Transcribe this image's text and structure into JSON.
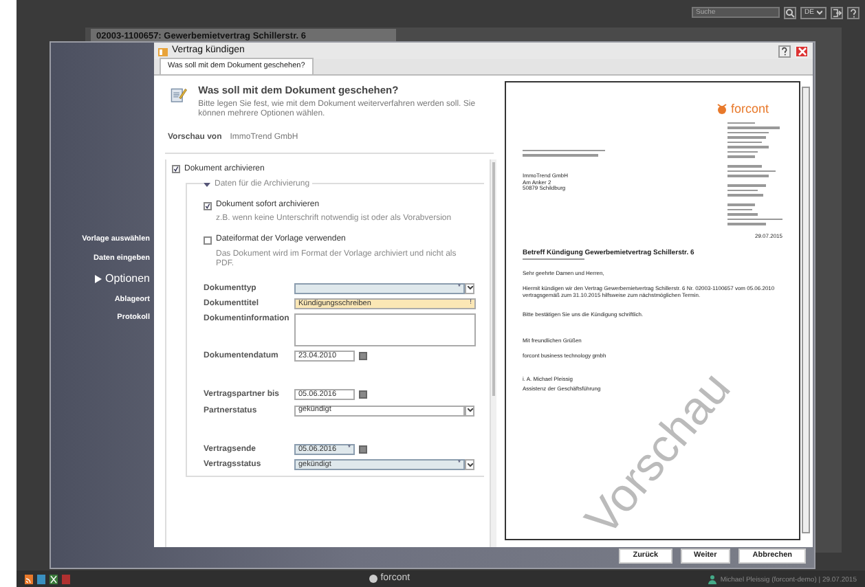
{
  "app_bar": {
    "search": {
      "placeholder": "Suche"
    },
    "language": "DE"
  },
  "background_window": {
    "title": "02003-1100657: Gewerbemietvertrag Schillerstr. 6"
  },
  "dialog": {
    "title": "Vertrag kündigen",
    "steps": [
      {
        "label": "Vorlage auswählen",
        "selected": false
      },
      {
        "label": "Daten eingeben",
        "selected": false
      },
      {
        "label": "Optionen",
        "selected": true
      },
      {
        "label": "Ablageort",
        "selected": false
      },
      {
        "label": "Protokoll",
        "selected": false
      }
    ],
    "tabs": [
      {
        "label": "Was soll mit dem Dokument geschehen?",
        "selected": true
      }
    ],
    "header": {
      "title": "Was soll mit dem Dokument geschehen?",
      "text": "Bitte legen Sie fest, wie mit dem Dokument weiterverfahren werden soll. Sie können mehrere Optionen wählen."
    },
    "preview_of": {
      "label": "Vorschau von",
      "value": "ImmoTrend GmbH"
    },
    "archive": {
      "label": "Dokument archivieren",
      "checked": true
    },
    "group": {
      "title": "Daten für die Archivierung",
      "expanded": true
    },
    "options": [
      {
        "label": "Dokument sofort archivieren",
        "hint": "z.B. wenn keine Unterschrift notwendig ist oder als Vorabversion",
        "checked": true
      },
      {
        "label": "Dateiformat der Vorlage verwenden",
        "hint": "Das Dokument wird im Format der Vorlage archiviert und nicht als PDF.",
        "checked": false
      }
    ],
    "field_groups": [
      [
        {
          "kind": "select",
          "label": "Dokumenttyp",
          "required": true,
          "warning": false,
          "marker": "*"
        },
        {
          "kind": "text",
          "label": "Dokumenttitel",
          "value": "Kündigungsschreiben",
          "required": false,
          "warning": true,
          "marker": "!"
        },
        {
          "kind": "textarea",
          "label": "Dokumentinformation",
          "required": false,
          "warning": false
        },
        {
          "kind": "date",
          "label": "Dokumentendatum",
          "value": "23.04.2010",
          "required": false,
          "warning": false
        }
      ],
      [
        {
          "kind": "date",
          "label": "Vertragspartner bis",
          "value": "05.06.2016",
          "required": false,
          "warning": false
        },
        {
          "kind": "select",
          "label": "Partnerstatus",
          "value": "gekündigt",
          "required": false,
          "warning": false
        }
      ],
      [
        {
          "kind": "date",
          "label": "Vertragsende",
          "value": "05.06.2016",
          "required": true,
          "warning": false,
          "marker": "*"
        },
        {
          "kind": "select",
          "label": "Vertragsstatus",
          "value": "gekündigt",
          "required": true,
          "warning": false,
          "marker": "*"
        }
      ]
    ],
    "preview_document": {
      "logo": "forcont",
      "recipient": [
        "ImmoTrend GmbH",
        "Am Anker 2",
        "50879 Schildburg"
      ],
      "date": "29.07.2015",
      "subject": "Betreff Kündigung Gewerbemietvertrag Schillerstr. 6",
      "salutation": "Sehr geehrte Damen und Herren,",
      "body": "Hiermit kündigen wir den Vertrag Gewerbemietvertrag Schillerstr. 6 Nr. 02003-1100657 vom 05.06.2010 vertragsgemäß zum 31.10.2015 hilfsweise zum nächstmöglichen Termin.",
      "request": "Bitte bestätigen Sie uns die Kündigung schriftlich.",
      "closing": "Mit freundlichen Grüßen",
      "company": "forcont business technology gmbh",
      "signature": "i. A. Michael Pleissig",
      "position": "Assistenz der Geschäftsführung",
      "watermark": "Vorschau"
    },
    "buttons": [
      "Zurück",
      "Weiter",
      "Abbrechen"
    ]
  },
  "taskbar": {
    "logo": "forcont",
    "user": "Michael Pleissig (forcont-demo) | 29.07.2015"
  }
}
